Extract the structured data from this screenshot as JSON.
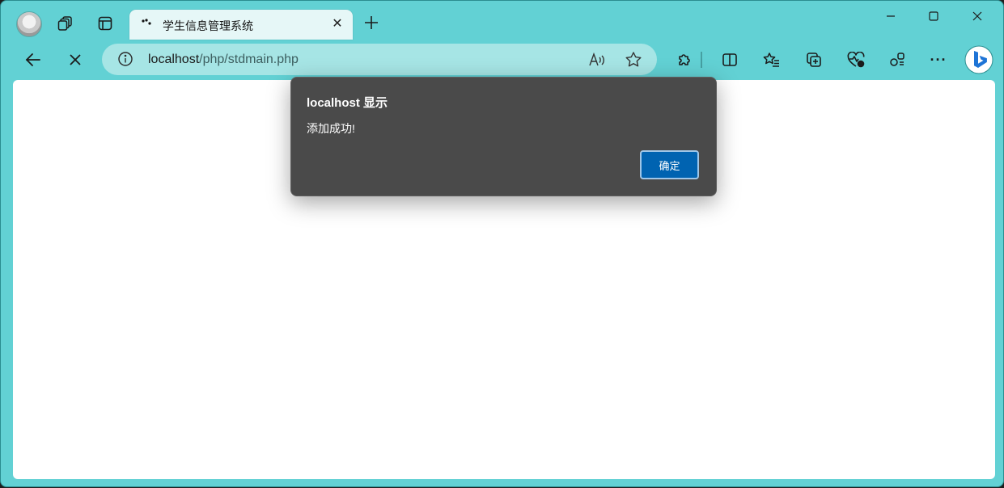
{
  "tab": {
    "title": "学生信息管理系统",
    "close_glyph": "✕"
  },
  "addressbar": {
    "host": "localhost",
    "path": "/php/stdmain.php",
    "info_glyph": "ⓘ"
  },
  "dialog": {
    "title": "localhost 显示",
    "message": "添加成功!",
    "ok_label": "确定"
  },
  "toolbar": {
    "more_glyph": "···"
  },
  "colors": {
    "frame": "#62d1d4",
    "address_bg": "#a6e5e5",
    "tab_bg": "#e6f7f7",
    "dialog_bg": "#4a4a4a",
    "ok_button": "#0063b1"
  },
  "icons": [
    "profile-avatar",
    "workspaces-icon",
    "tab-actions-icon",
    "page-loading-icon",
    "close-icon",
    "new-tab-icon",
    "minimize-icon",
    "maximize-icon",
    "window-close-icon",
    "back-icon",
    "stop-icon",
    "info-icon",
    "read-aloud-icon",
    "favorite-star-icon",
    "extensions-icon",
    "split-screen-icon",
    "favorites-icon",
    "collections-icon",
    "browser-essentials-icon",
    "copilot-sidebar-icon",
    "more-icon",
    "bing-icon"
  ]
}
